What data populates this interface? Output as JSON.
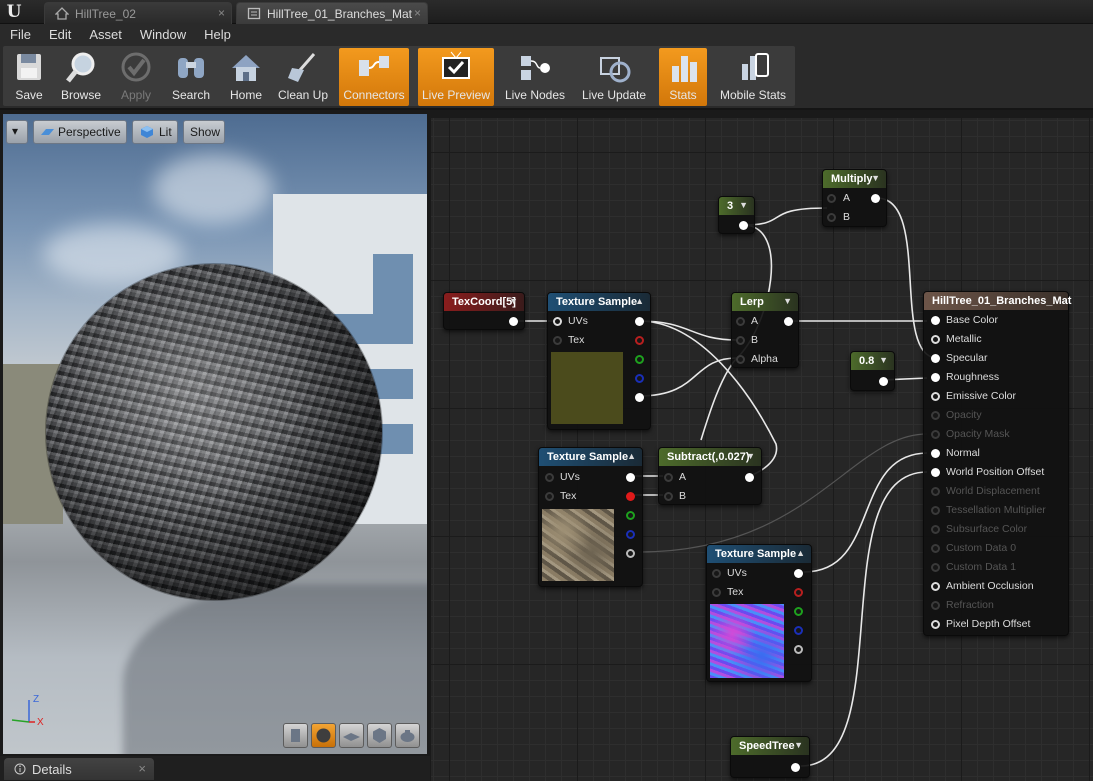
{
  "tabs": [
    {
      "label": "HillTree_02",
      "close": "×"
    },
    {
      "label": "HillTree_01_Branches_Mat",
      "close": "×"
    }
  ],
  "menu": [
    "File",
    "Edit",
    "Asset",
    "Window",
    "Help"
  ],
  "toolbar": [
    {
      "label": "Save",
      "icon": "floppy-disk-icon"
    },
    {
      "label": "Browse",
      "icon": "magnifier-icon"
    },
    {
      "label": "Apply",
      "icon": "checkmark-icon",
      "disabled": true
    },
    {
      "label": "Search",
      "icon": "binoculars-icon"
    },
    {
      "label": "Home",
      "icon": "house-icon"
    },
    {
      "label": "Clean Up",
      "icon": "broom-icon"
    },
    {
      "label": "Connectors",
      "icon": "connectors-icon",
      "active": true
    },
    {
      "label": "Live Preview",
      "icon": "tv-check-icon",
      "active": true
    },
    {
      "label": "Live Nodes",
      "icon": "live-nodes-icon"
    },
    {
      "label": "Live Update",
      "icon": "live-update-icon"
    },
    {
      "label": "Stats",
      "icon": "bar-stats-icon",
      "active": true
    },
    {
      "label": "Mobile Stats",
      "icon": "mobile-stats-icon"
    }
  ],
  "viewport": {
    "menu_arrow": "▾",
    "perspective": "Perspective",
    "lit": "Lit",
    "show": "Show",
    "axis_z": "Z",
    "axis_x": "X",
    "preview_buttons": [
      "cylinder-icon",
      "sphere-icon",
      "plane-icon",
      "cube-icon",
      "teapot-icon"
    ],
    "active_preview": "sphere-icon"
  },
  "details": {
    "label": "Details",
    "close": "×"
  },
  "graph": {
    "const3": {
      "value": "3"
    },
    "multiply": {
      "title": "Multiply",
      "pins": [
        "A",
        "B"
      ]
    },
    "texcoord": {
      "title": "TexCoord[5]"
    },
    "texsample1": {
      "title": "Texture Sample",
      "pins": [
        "UVs",
        "Tex"
      ],
      "swatch": "#4a4a1c"
    },
    "lerp": {
      "title": "Lerp",
      "pins": [
        "A",
        "B",
        "Alpha"
      ]
    },
    "const08": {
      "value": "0.8"
    },
    "texsample2": {
      "title": "Texture Sample",
      "pins": [
        "UVs",
        "Tex"
      ]
    },
    "subtract": {
      "title": "Subtract(,0.027)",
      "pins": [
        "A",
        "B"
      ]
    },
    "texsample3": {
      "title": "Texture Sample",
      "pins": [
        "UVs",
        "Tex"
      ]
    },
    "speedtree": {
      "title": "SpeedTree"
    },
    "material": {
      "title": "HillTree_01_Branches_Mat",
      "pins": [
        {
          "label": "Base Color",
          "state": "wired"
        },
        {
          "label": "Metallic",
          "state": "open"
        },
        {
          "label": "Specular",
          "state": "wired"
        },
        {
          "label": "Roughness",
          "state": "wired"
        },
        {
          "label": "Emissive Color",
          "state": "open"
        },
        {
          "label": "Opacity",
          "state": "disabled"
        },
        {
          "label": "Opacity Mask",
          "state": "disabled"
        },
        {
          "label": "Normal",
          "state": "wired"
        },
        {
          "label": "World Position Offset",
          "state": "wired"
        },
        {
          "label": "World Displacement",
          "state": "disabled"
        },
        {
          "label": "Tessellation Multiplier",
          "state": "disabled"
        },
        {
          "label": "Subsurface Color",
          "state": "disabled"
        },
        {
          "label": "Custom Data 0",
          "state": "disabled"
        },
        {
          "label": "Custom Data 1",
          "state": "disabled"
        },
        {
          "label": "Ambient Occlusion",
          "state": "open"
        },
        {
          "label": "Refraction",
          "state": "disabled"
        },
        {
          "label": "Pixel Depth Offset",
          "state": "open"
        }
      ]
    }
  }
}
